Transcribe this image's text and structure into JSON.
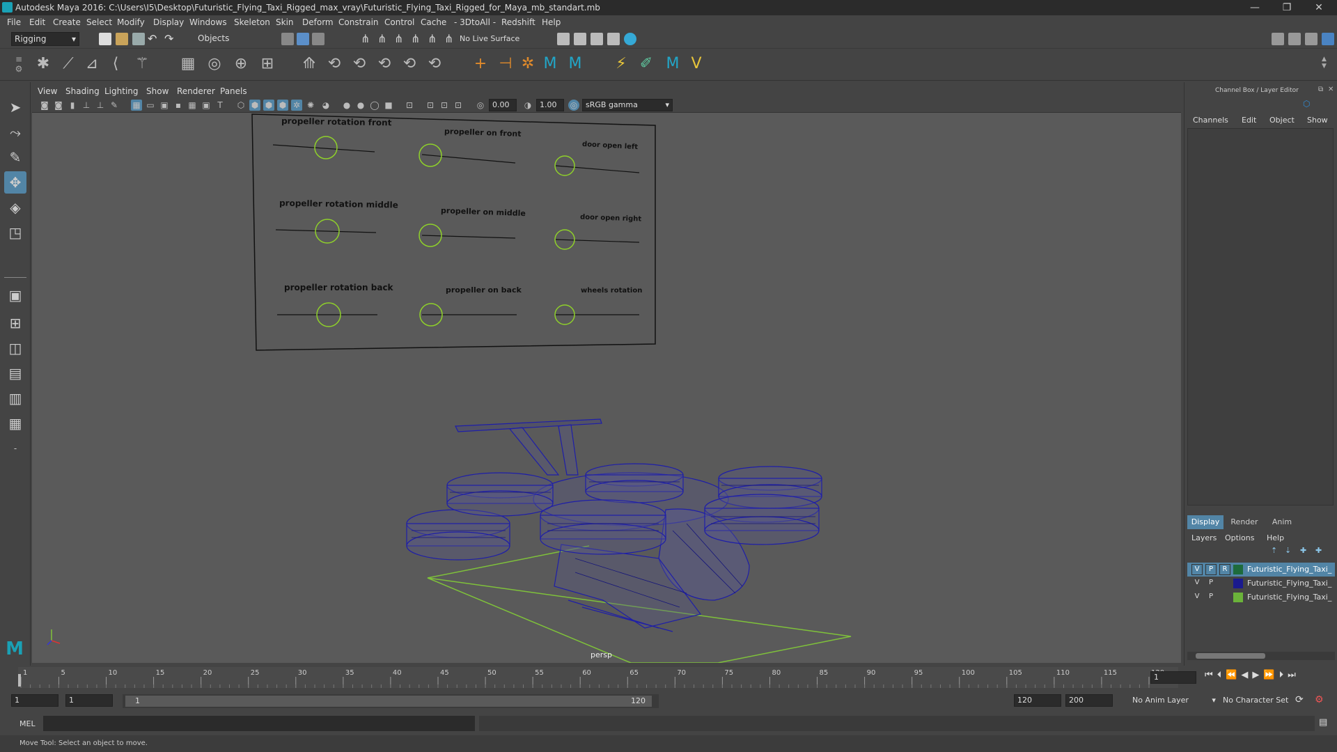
{
  "window": {
    "title": "Autodesk Maya 2016: C:\\Users\\I5\\Desktop\\Futuristic_Flying_Taxi_Rigged_max_vray\\Futuristic_Flying_Taxi_Rigged_for_Maya_mb_standart.mb",
    "minimize": "—",
    "restore": "❐",
    "close": "✕"
  },
  "menubar": [
    "File",
    "Edit",
    "Create",
    "Select",
    "Modify",
    "Display",
    "Windows",
    "Skeleton",
    "Skin",
    "Deform",
    "Constrain",
    "Control",
    "Cache",
    "- 3DtoAll -",
    "Redshift",
    "Help"
  ],
  "statusline": {
    "menuset": "Rigging",
    "objects": "Objects",
    "live_surface": "No Live Surface"
  },
  "panel": {
    "menus": [
      "View",
      "Shading",
      "Lighting",
      "Show",
      "Renderer",
      "Panels"
    ],
    "exposure": "0.00",
    "gamma": "1.00",
    "colorspace": "sRGB gamma",
    "camera": "persp"
  },
  "controls": {
    "labels": [
      "propeller rotation front",
      "propeller on front",
      "door open left",
      "propeller rotation middle",
      "propeller on middle",
      "door open right",
      "propeller rotation back",
      "propeller on back",
      "wheels rotation"
    ]
  },
  "channelbox": {
    "header": "Channel Box / Layer Editor",
    "tabs": [
      "Channels",
      "Edit",
      "Object",
      "Show"
    ]
  },
  "layers": {
    "tabs": [
      "Display",
      "Render",
      "Anim"
    ],
    "menus": [
      "Layers",
      "Options",
      "Help"
    ],
    "rows": [
      {
        "v": "V",
        "p": "P",
        "r": "R",
        "name": "Futuristic_Flying_Taxi_",
        "color": "#1d6b3c"
      },
      {
        "v": "V",
        "p": "P",
        "r": "",
        "name": "Futuristic_Flying_Taxi_",
        "color": "#1a1a8e"
      },
      {
        "v": "V",
        "p": "P",
        "r": "",
        "name": "Futuristic_Flying_Taxi_",
        "color": "#6bb33a"
      }
    ]
  },
  "timeline": {
    "ticks": [
      "1",
      "5",
      "10",
      "15",
      "20",
      "25",
      "30",
      "35",
      "40",
      "45",
      "50",
      "55",
      "60",
      "65",
      "70",
      "75",
      "80",
      "85",
      "90",
      "95",
      "100",
      "105",
      "110",
      "115",
      "120"
    ],
    "current_frame": "1"
  },
  "range": {
    "start": "1",
    "playback_start": "1",
    "slider_start": "1",
    "slider_end": "120",
    "playback_end": "120",
    "end": "200",
    "anim_layer": "No Anim Layer",
    "character_set": "No Character Set"
  },
  "cmdline": {
    "label": "MEL"
  },
  "helpline": {
    "text": "Move Tool: Select an object to move."
  }
}
